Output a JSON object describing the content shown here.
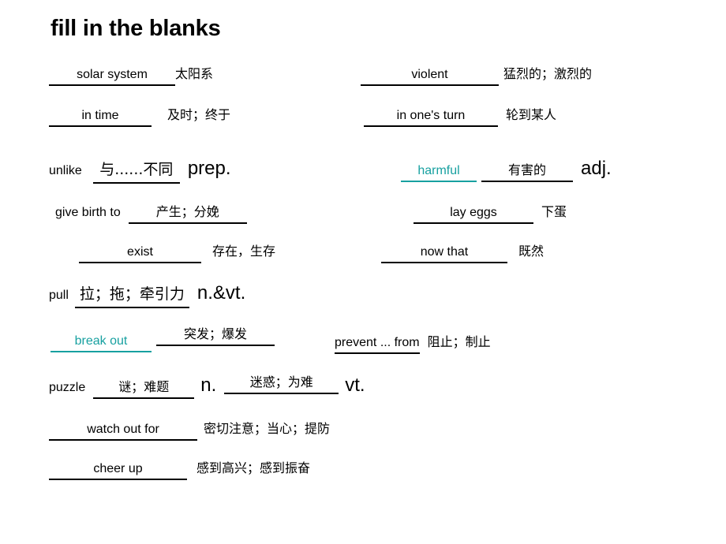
{
  "slide": {
    "title": "fill in the blanks",
    "accent_color": "#17a0a0",
    "text_color": "#000000",
    "background_color": "#ffffff"
  },
  "entries": [
    {
      "id": "solar-system",
      "term": "solar system",
      "term_style": "blank-black",
      "meaning": "太阳系",
      "meaning_style": "plain",
      "pos": "",
      "column": "left",
      "row": 1
    },
    {
      "id": "violent",
      "term": "violent",
      "term_style": "blank-black",
      "meaning": "猛烈的；激烈的",
      "meaning_style": "plain",
      "pos": "",
      "column": "right",
      "row": 1
    },
    {
      "id": "in-time",
      "term": "in time",
      "term_style": "blank-black",
      "meaning": "及时；终于",
      "meaning_style": "plain",
      "pos": "",
      "column": "left",
      "row": 2
    },
    {
      "id": "in-ones-turn",
      "term": "in one's turn",
      "term_style": "blank-black",
      "meaning": "轮到某人",
      "meaning_style": "plain",
      "pos": "",
      "column": "right",
      "row": 2
    },
    {
      "id": "unlike",
      "term": "unlike",
      "term_style": "plain",
      "meaning": "与......不同",
      "meaning_style": "blank-black",
      "pos": "prep.",
      "column": "left",
      "row": 3
    },
    {
      "id": "harmful",
      "term": "harmful",
      "term_style": "teal-underline",
      "meaning": "有害的",
      "meaning_style": "blank-black",
      "pos": "adj.",
      "column": "right",
      "row": 3
    },
    {
      "id": "give-birth-to",
      "term": "give birth to",
      "term_style": "plain",
      "meaning": "产生；分娩",
      "meaning_style": "blank-black",
      "pos": "",
      "column": "left",
      "row": 4
    },
    {
      "id": "lay-eggs",
      "term": "lay eggs",
      "term_style": "blank-black",
      "meaning": "下蛋",
      "meaning_style": "plain",
      "pos": "",
      "column": "right",
      "row": 4
    },
    {
      "id": "exist",
      "term": "exist",
      "term_style": "blank-black",
      "meaning": "存在，生存",
      "meaning_style": "plain",
      "pos": "",
      "column": "left",
      "row": 5
    },
    {
      "id": "now-that",
      "term": "now that",
      "term_style": "blank-black",
      "meaning": "既然",
      "meaning_style": "plain",
      "pos": "",
      "column": "right",
      "row": 5
    },
    {
      "id": "pull",
      "term": "pull",
      "term_style": "plain",
      "meaning": "拉；拖；牵引力",
      "meaning_style": "blank-black-small",
      "pos": "n.&vt.",
      "column": "left",
      "row": 6
    },
    {
      "id": "break-out",
      "term": "break out",
      "term_style": "teal-underline",
      "meaning": "突发；爆发",
      "meaning_style": "blank-black",
      "pos": "",
      "column": "left",
      "row": 7
    },
    {
      "id": "prevent-from",
      "term": "prevent ... from",
      "term_style": "partial-underline",
      "meaning": "阻止；制止",
      "meaning_style": "plain",
      "pos": "",
      "column": "right",
      "row": 7
    },
    {
      "id": "puzzle",
      "term": "puzzle",
      "term_style": "plain",
      "meaning": "谜；难题",
      "meaning_style": "blank-black",
      "pos": "n.",
      "meaning2": "迷惑；为难",
      "pos2": "vt.",
      "column": "left",
      "row": 8
    },
    {
      "id": "watch-out-for",
      "term": "watch out for",
      "term_style": "blank-black",
      "meaning": "密切注意；当心；提防",
      "meaning_style": "plain",
      "pos": "",
      "column": "left",
      "row": 9
    },
    {
      "id": "cheer-up",
      "term": "cheer up",
      "term_style": "blank-black",
      "meaning": "感到高兴；感到振奋",
      "meaning_style": "plain",
      "pos": "",
      "column": "left",
      "row": 10
    }
  ]
}
